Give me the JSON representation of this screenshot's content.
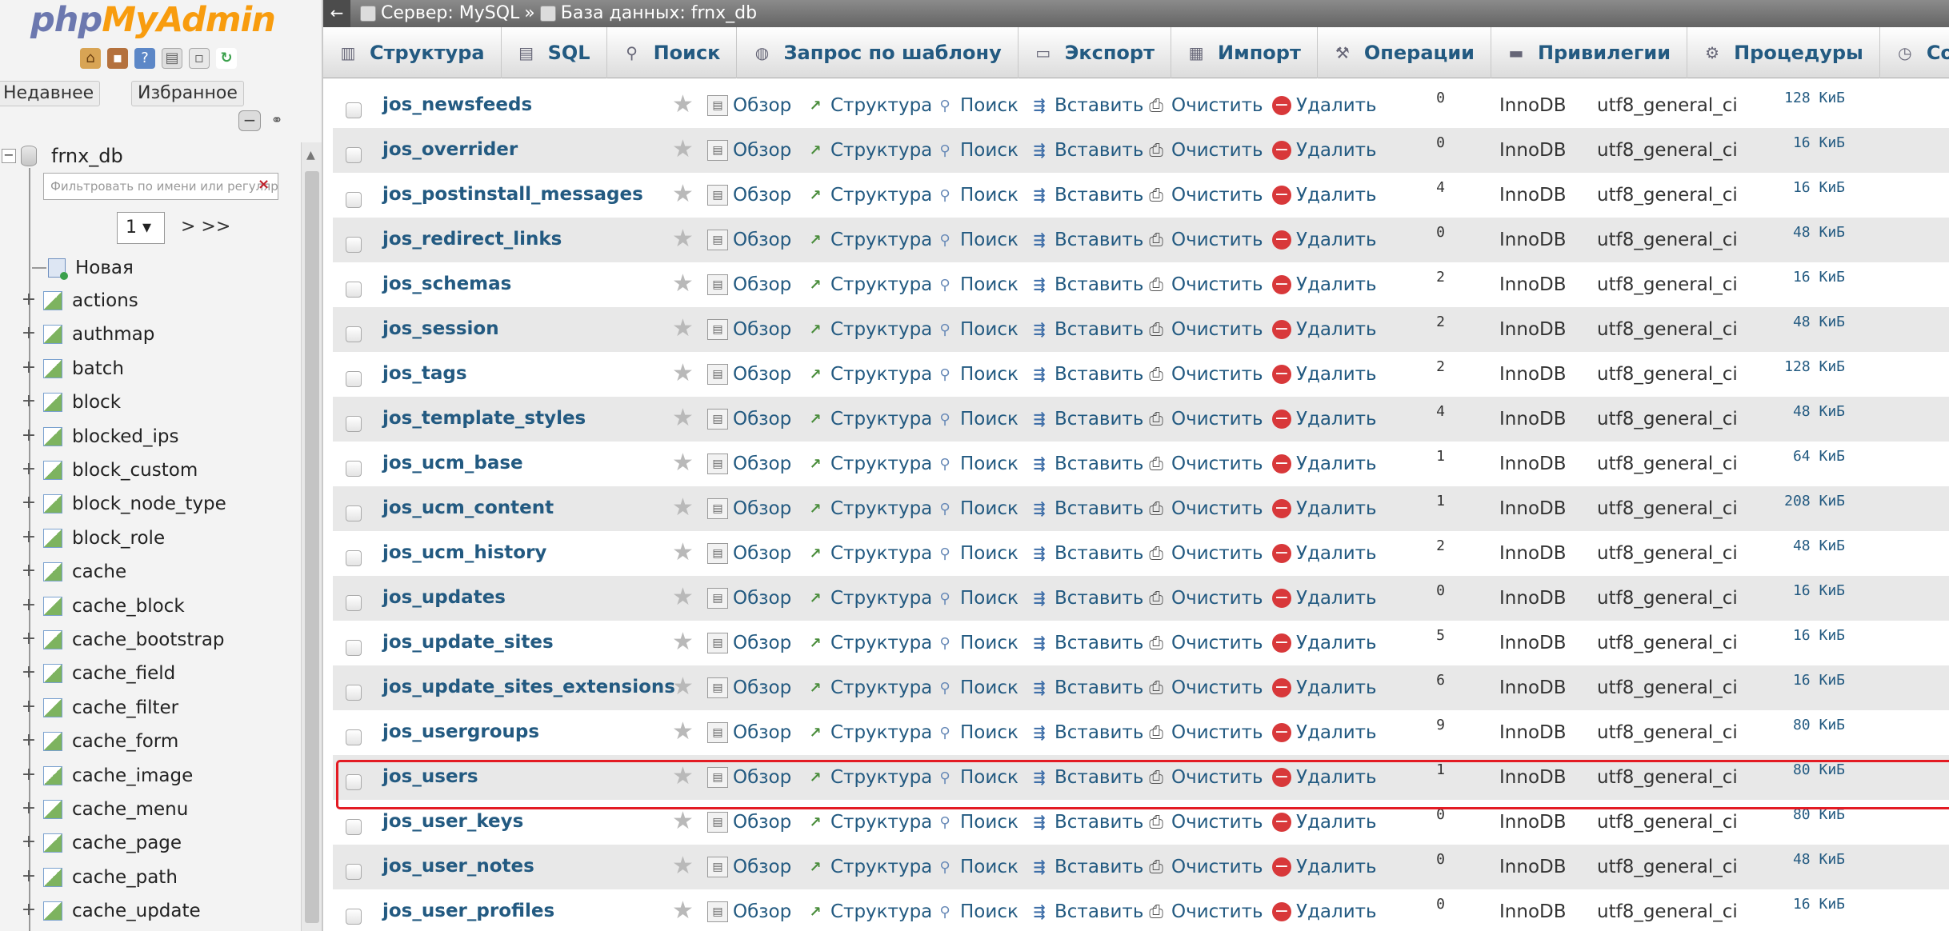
{
  "logo": {
    "part1": "php",
    "part2": "MyAdmin"
  },
  "nav": {
    "icons": [
      "home-icon",
      "logout-icon",
      "help-icon",
      "docs-icon",
      "settings-icon",
      "reload-icon"
    ],
    "tab_recent": "Недавнее",
    "tab_favorites": "Избранное",
    "db_name": "frnx_db",
    "filter_placeholder": "Фильтровать по имени или регулярному выражению",
    "page_value": "1",
    "page_next": "> >>",
    "new_label": "Новая",
    "tables": [
      "actions",
      "authmap",
      "batch",
      "block",
      "blocked_ips",
      "block_custom",
      "block_node_type",
      "block_role",
      "cache",
      "cache_block",
      "cache_bootstrap",
      "cache_field",
      "cache_filter",
      "cache_form",
      "cache_image",
      "cache_menu",
      "cache_page",
      "cache_path",
      "cache_update"
    ]
  },
  "breadcrumb": {
    "back": "←",
    "server": "Сервер: MySQL",
    "sep": "»",
    "database": "База данных: frnx_db"
  },
  "menu": {
    "tabs": [
      {
        "label": "Структура",
        "icon": "structure-icon"
      },
      {
        "label": "SQL",
        "icon": "sql-icon"
      },
      {
        "label": "Поиск",
        "icon": "search-icon"
      },
      {
        "label": "Запрос по шаблону",
        "icon": "query-icon"
      },
      {
        "label": "Экспорт",
        "icon": "export-icon"
      },
      {
        "label": "Импорт",
        "icon": "import-icon"
      },
      {
        "label": "Операции",
        "icon": "wrench-icon"
      },
      {
        "label": "Привилегии",
        "icon": "privileges-icon"
      },
      {
        "label": "Процедуры",
        "icon": "routines-icon"
      },
      {
        "label": "События",
        "icon": "events-icon"
      }
    ]
  },
  "actions": {
    "browse": "Обзор",
    "structure": "Структура",
    "search": "Поиск",
    "insert": "Вставить",
    "empty": "Очистить",
    "drop": "Удалить"
  },
  "colors": {
    "link": "#235a81",
    "highlight": "#e31b23",
    "drop": "#d8383a"
  },
  "rows": [
    {
      "name": "jos_newsfeeds",
      "rows": "0",
      "engine": "InnoDB",
      "collation": "utf8_general_ci",
      "size": "128 КиБ"
    },
    {
      "name": "jos_overrider",
      "rows": "0",
      "engine": "InnoDB",
      "collation": "utf8_general_ci",
      "size": "16 КиБ"
    },
    {
      "name": "jos_postinstall_messages",
      "rows": "4",
      "engine": "InnoDB",
      "collation": "utf8_general_ci",
      "size": "16 КиБ"
    },
    {
      "name": "jos_redirect_links",
      "rows": "0",
      "engine": "InnoDB",
      "collation": "utf8_general_ci",
      "size": "48 КиБ"
    },
    {
      "name": "jos_schemas",
      "rows": "2",
      "engine": "InnoDB",
      "collation": "utf8_general_ci",
      "size": "16 КиБ"
    },
    {
      "name": "jos_session",
      "rows": "2",
      "engine": "InnoDB",
      "collation": "utf8_general_ci",
      "size": "48 КиБ"
    },
    {
      "name": "jos_tags",
      "rows": "2",
      "engine": "InnoDB",
      "collation": "utf8_general_ci",
      "size": "128 КиБ"
    },
    {
      "name": "jos_template_styles",
      "rows": "4",
      "engine": "InnoDB",
      "collation": "utf8_general_ci",
      "size": "48 КиБ"
    },
    {
      "name": "jos_ucm_base",
      "rows": "1",
      "engine": "InnoDB",
      "collation": "utf8_general_ci",
      "size": "64 КиБ"
    },
    {
      "name": "jos_ucm_content",
      "rows": "1",
      "engine": "InnoDB",
      "collation": "utf8_general_ci",
      "size": "208 КиБ"
    },
    {
      "name": "jos_ucm_history",
      "rows": "2",
      "engine": "InnoDB",
      "collation": "utf8_general_ci",
      "size": "48 КиБ"
    },
    {
      "name": "jos_updates",
      "rows": "0",
      "engine": "InnoDB",
      "collation": "utf8_general_ci",
      "size": "16 КиБ"
    },
    {
      "name": "jos_update_sites",
      "rows": "5",
      "engine": "InnoDB",
      "collation": "utf8_general_ci",
      "size": "16 КиБ"
    },
    {
      "name": "jos_update_sites_extensions",
      "rows": "6",
      "engine": "InnoDB",
      "collation": "utf8_general_ci",
      "size": "16 КиБ"
    },
    {
      "name": "jos_usergroups",
      "rows": "9",
      "engine": "InnoDB",
      "collation": "utf8_general_ci",
      "size": "80 КиБ"
    },
    {
      "name": "jos_users",
      "rows": "1",
      "engine": "InnoDB",
      "collation": "utf8_general_ci",
      "size": "80 КиБ"
    },
    {
      "name": "jos_user_keys",
      "rows": "0",
      "engine": "InnoDB",
      "collation": "utf8_general_ci",
      "size": "80 КиБ"
    },
    {
      "name": "jos_user_notes",
      "rows": "0",
      "engine": "InnoDB",
      "collation": "utf8_general_ci",
      "size": "48 КиБ"
    },
    {
      "name": "jos_user_profiles",
      "rows": "0",
      "engine": "InnoDB",
      "collation": "utf8_general_ci",
      "size": "16 КиБ"
    }
  ]
}
